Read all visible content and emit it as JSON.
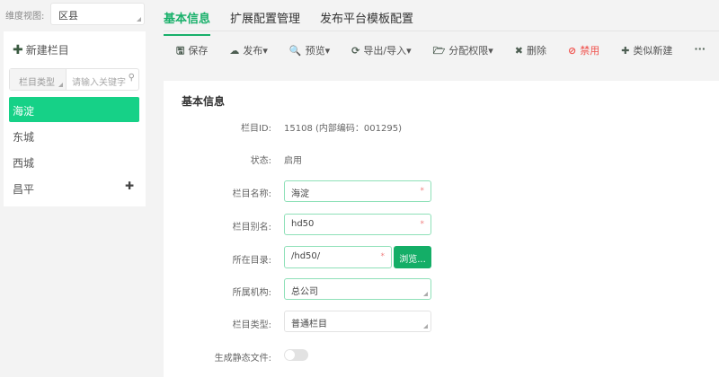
{
  "dimension": {
    "label": "维度视图:",
    "value": "区县"
  },
  "sidebar": {
    "new_label": "新建栏目",
    "filter_type": "栏目类型",
    "search_placeholder": "请输入关键字",
    "items": [
      {
        "label": "海淀",
        "active": true
      },
      {
        "label": "东城"
      },
      {
        "label": "西城"
      },
      {
        "label": "昌平",
        "expandable": true
      }
    ]
  },
  "tabs": [
    {
      "label": "基本信息",
      "active": true
    },
    {
      "label": "扩展配置管理"
    },
    {
      "label": "发布平台模板配置"
    }
  ],
  "toolbar": [
    {
      "icon": "save-icon",
      "glyph": "🖫",
      "label": "保存"
    },
    {
      "icon": "cloud-upload-icon",
      "glyph": "☁",
      "label": "发布▾"
    },
    {
      "icon": "search-icon",
      "glyph": "🔍",
      "label": "预览▾"
    },
    {
      "icon": "refresh-icon",
      "glyph": "⟳",
      "label": "导出/导入▾"
    },
    {
      "icon": "folder-icon",
      "glyph": "🗁",
      "label": "分配权限▾"
    },
    {
      "icon": "close-icon",
      "glyph": "✖",
      "label": "删除"
    },
    {
      "icon": "ban-icon",
      "glyph": "⊘",
      "label": "禁用",
      "danger": true
    },
    {
      "icon": "plus-icon",
      "glyph": "✚",
      "label": "类似新建"
    },
    {
      "icon": "more-icon",
      "glyph": "···",
      "label": ""
    }
  ],
  "colors": {
    "accent": "#18b06a",
    "active_item": "#16d187",
    "danger": "#f0544f"
  },
  "form": {
    "section": "基本信息",
    "id_label": "栏目ID:",
    "id_value": "15108 (内部编码：001295)",
    "status_label": "状态:",
    "status_value": "启用",
    "name_label": "栏目名称:",
    "name_value": "海淀",
    "alias_label": "栏目别名:",
    "alias_value": "hd50",
    "dir_label": "所在目录:",
    "dir_value": "/hd50/",
    "browse": "浏览...",
    "org_label": "所属机构:",
    "org_value": "总公司",
    "type_label": "栏目类型:",
    "type_value": "普通栏目",
    "static_label": "生成静态文件:",
    "static_on": false,
    "required_mark": "*"
  }
}
